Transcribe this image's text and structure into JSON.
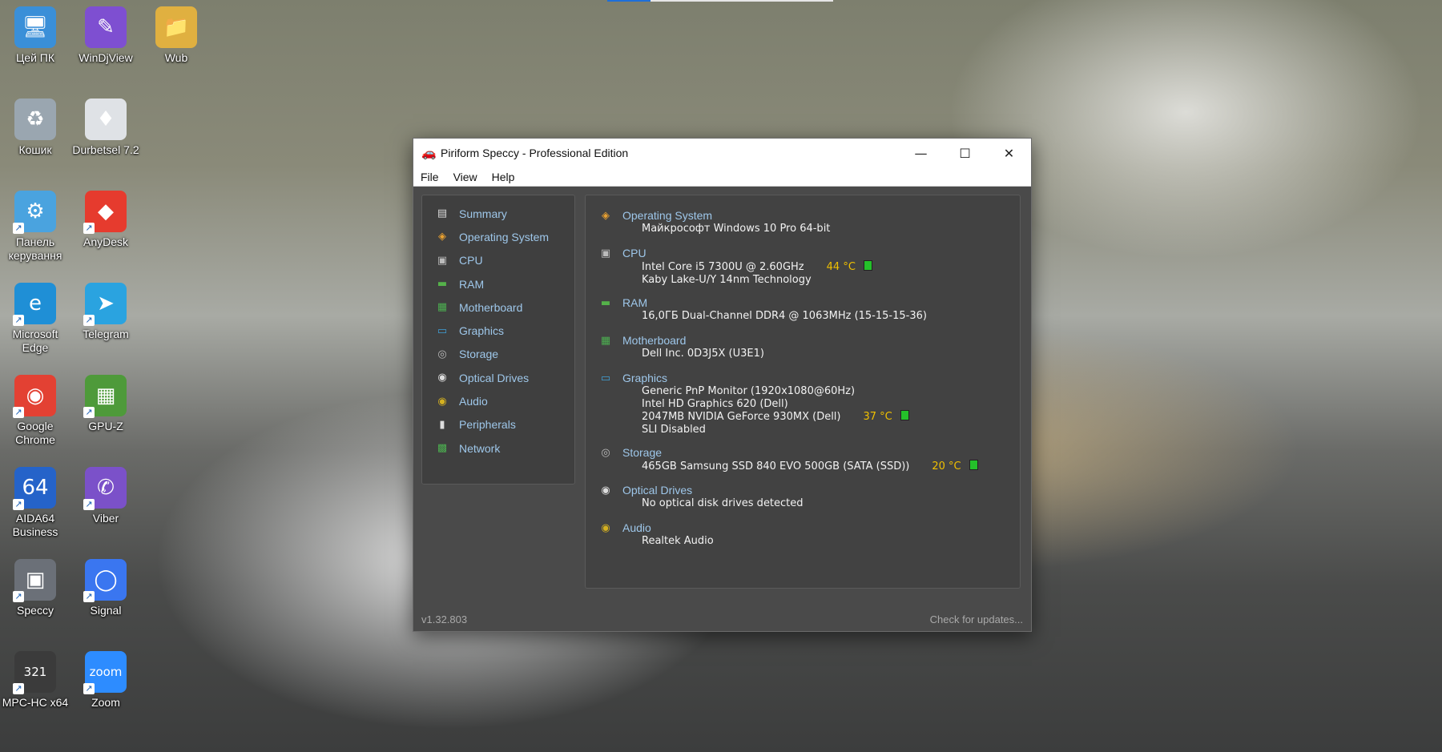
{
  "desktop": {
    "icons": [
      {
        "label": "Цей ПК",
        "glyph": "🖥",
        "color": "#3a8fd8"
      },
      {
        "label": "WinDjView",
        "glyph": "✎",
        "color": "#7e4fd1"
      },
      {
        "label": "Wub",
        "glyph": "📁",
        "color": "#e0b040"
      },
      {
        "label": "Кошик",
        "glyph": "♻",
        "color": "#9aa6b0"
      },
      {
        "label": "Durbetsel 7.2",
        "glyph": "♦",
        "color": "#dfe2e6"
      },
      {
        "label": "Панель керування",
        "glyph": "⚙",
        "color": "#4aa3df"
      },
      {
        "label": "AnyDesk",
        "glyph": "◆",
        "color": "#e63b2e"
      },
      {
        "label": "Microsoft Edge",
        "glyph": "e",
        "color": "#1f8fd6"
      },
      {
        "label": "Telegram",
        "glyph": "➤",
        "color": "#2aa3e0"
      },
      {
        "label": "Google Chrome",
        "glyph": "◉",
        "color": "#e34133"
      },
      {
        "label": "GPU-Z",
        "glyph": "▦",
        "color": "#4e9a3a"
      },
      {
        "label": "AIDA64 Business",
        "glyph": "64",
        "color": "#2563c9"
      },
      {
        "label": "Viber",
        "glyph": "✆",
        "color": "#7b51c9"
      },
      {
        "label": "Speccy",
        "glyph": "▣",
        "color": "#6b7078"
      },
      {
        "label": "Signal",
        "glyph": "◯",
        "color": "#3a76f0"
      },
      {
        "label": "MPC-HC x64",
        "glyph": "321",
        "color": "#3b3b3b"
      },
      {
        "label": "Zoom",
        "glyph": "zoom",
        "color": "#2d8cff"
      }
    ],
    "shortcut_arrow": "↗"
  },
  "window": {
    "title": "Piriform Speccy - Professional Edition",
    "app_icon": "🚗",
    "controls": {
      "minimize": "—",
      "maximize": "☐",
      "close": "✕"
    },
    "menu": [
      "File",
      "View",
      "Help"
    ],
    "nav": [
      {
        "label": "Summary",
        "icon": "▤",
        "icon_color": "#d8d8d8"
      },
      {
        "label": "Operating System",
        "icon": "◈",
        "icon_color": "#e8a030"
      },
      {
        "label": "CPU",
        "icon": "▣",
        "icon_color": "#bbbbbb"
      },
      {
        "label": "RAM",
        "icon": "▬",
        "icon_color": "#55b24a"
      },
      {
        "label": "Motherboard",
        "icon": "▦",
        "icon_color": "#4cae50"
      },
      {
        "label": "Graphics",
        "icon": "▭",
        "icon_color": "#3fa0d8"
      },
      {
        "label": "Storage",
        "icon": "◎",
        "icon_color": "#bbbbbb"
      },
      {
        "label": "Optical Drives",
        "icon": "◉",
        "icon_color": "#dddddd"
      },
      {
        "label": "Audio",
        "icon": "◉",
        "icon_color": "#d4b020"
      },
      {
        "label": "Peripherals",
        "icon": "▮",
        "icon_color": "#dddddd"
      },
      {
        "label": "Network",
        "icon": "▩",
        "icon_color": "#4cae50"
      }
    ],
    "sections": [
      {
        "title": "Operating System",
        "icon": "◈",
        "icon_color": "#e8a030",
        "lines": [
          {
            "text": "Майкрософт Windows 10 Pro 64-bit"
          }
        ]
      },
      {
        "title": "CPU",
        "icon": "▣",
        "icon_color": "#bbbbbb",
        "lines": [
          {
            "text": "Intel Core i5 7300U @ 2.60GHz",
            "temp": "44 °C"
          },
          {
            "text": "Kaby Lake-U/Y 14nm Technology"
          }
        ]
      },
      {
        "title": "RAM",
        "icon": "▬",
        "icon_color": "#55b24a",
        "lines": [
          {
            "text": "16,0ГБ Dual-Channel DDR4 @ 1063MHz (15-15-15-36)"
          }
        ]
      },
      {
        "title": "Motherboard",
        "icon": "▦",
        "icon_color": "#4cae50",
        "lines": [
          {
            "text": "Dell Inc. 0D3J5X (U3E1)"
          }
        ]
      },
      {
        "title": "Graphics",
        "icon": "▭",
        "icon_color": "#3fa0d8",
        "lines": [
          {
            "text": "Generic PnP Monitor (1920x1080@60Hz)"
          },
          {
            "text": "Intel HD Graphics 620 (Dell)"
          },
          {
            "text": "2047MB NVIDIA GeForce 930MX (Dell)",
            "temp": "37 °C"
          },
          {
            "text": "SLI Disabled"
          }
        ]
      },
      {
        "title": "Storage",
        "icon": "◎",
        "icon_color": "#bbbbbb",
        "lines": [
          {
            "text": "465GB Samsung SSD 840 EVO 500GB (SATA (SSD))",
            "temp": "20 °C"
          }
        ]
      },
      {
        "title": "Optical Drives",
        "icon": "◉",
        "icon_color": "#dddddd",
        "lines": [
          {
            "text": "No optical disk drives detected"
          }
        ]
      },
      {
        "title": "Audio",
        "icon": "◉",
        "icon_color": "#d4b020",
        "lines": [
          {
            "text": "Realtek Audio"
          }
        ]
      }
    ],
    "version": "v1.32.803",
    "check_updates": "Check for updates..."
  }
}
